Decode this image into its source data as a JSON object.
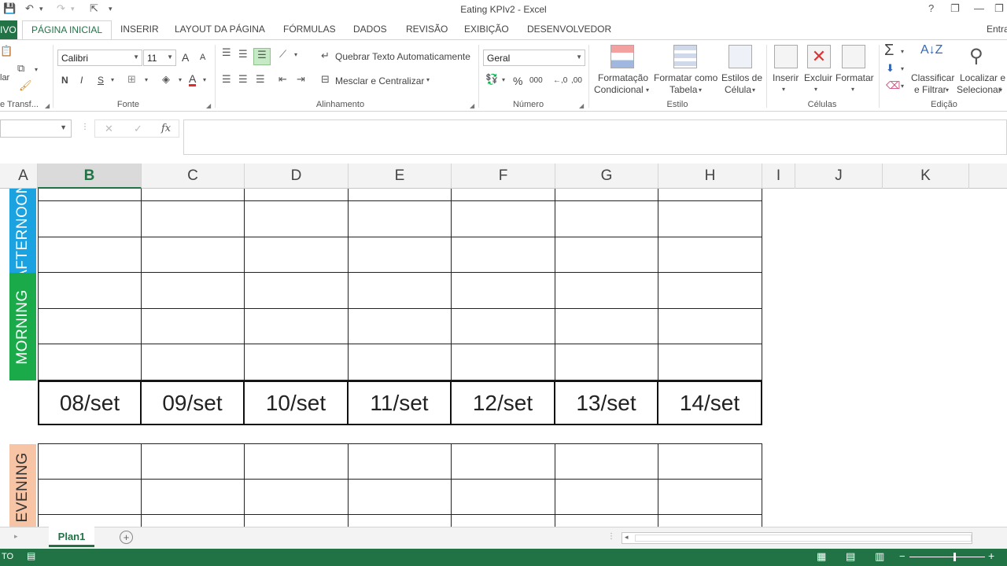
{
  "window": {
    "title": "Eating KPIv2 - Excel",
    "help": "?",
    "restore": "❐",
    "minimize": "—",
    "close": "✕"
  },
  "qat": {
    "save": "💾",
    "undo": "↶",
    "redo": "↷",
    "customize": "▾"
  },
  "tabs": {
    "file": "IVO",
    "items": [
      "PÁGINA INICIAL",
      "INSERIR",
      "LAYOUT DA PÁGINA",
      "FÓRMULAS",
      "DADOS",
      "REVISÃO",
      "EXIBIÇÃO",
      "DESENVOLVEDOR"
    ],
    "account": "Entra"
  },
  "ribbon": {
    "clipboard": {
      "paste_fragment": "lar",
      "label": "e Transf..."
    },
    "font": {
      "name": "Calibri",
      "size": "11",
      "bold": "N",
      "italic": "I",
      "underline": "S",
      "grow": "A",
      "shrink": "A",
      "color_glyph": "A",
      "label": "Fonte"
    },
    "alignment": {
      "wrap": "Quebrar Texto Automaticamente",
      "merge": "Mesclar e Centralizar",
      "label": "Alinhamento"
    },
    "number": {
      "format": "Geral",
      "percent": "%",
      "thousands": "000",
      "inc_decimal": "←,0",
      "dec_decimal": ",00",
      "label": "Número"
    },
    "styles": {
      "conditional_1": "Formatação",
      "conditional_2": "Condicional",
      "table_1": "Formatar como",
      "table_2": "Tabela",
      "cell_1": "Estilos de",
      "cell_2": "Célula",
      "label": "Estilo"
    },
    "cells": {
      "insert": "Inserir",
      "delete": "Excluir",
      "format": "Formatar",
      "label": "Células"
    },
    "editing": {
      "sum": "Σ",
      "sort_1": "Classificar",
      "sort_2": "e Filtrar",
      "find_1": "Localizar e",
      "find_2": "Selecionar",
      "label": "Edição"
    }
  },
  "formula_bar": {
    "cancel": "✕",
    "enter": "✓",
    "fx": "fx",
    "value": ""
  },
  "columns": [
    "A",
    "B",
    "C",
    "D",
    "E",
    "F",
    "G",
    "H",
    "I",
    "J",
    "K"
  ],
  "selected_column": "B",
  "bands": {
    "afternoon": {
      "label": "AFTERNOON",
      "color": "#1aa3e0"
    },
    "morning": {
      "label": "MORNING",
      "color": "#1aaa4a"
    },
    "evening": {
      "label": "EVENING",
      "color": "#f7c4a6"
    }
  },
  "dates": [
    "08/set",
    "09/set",
    "10/set",
    "11/set",
    "12/set",
    "13/set",
    "14/set"
  ],
  "sheets": {
    "active": "Plan1",
    "add": "+"
  },
  "status": {
    "ready": "TO"
  },
  "colors": {
    "excel_green": "#217346"
  }
}
